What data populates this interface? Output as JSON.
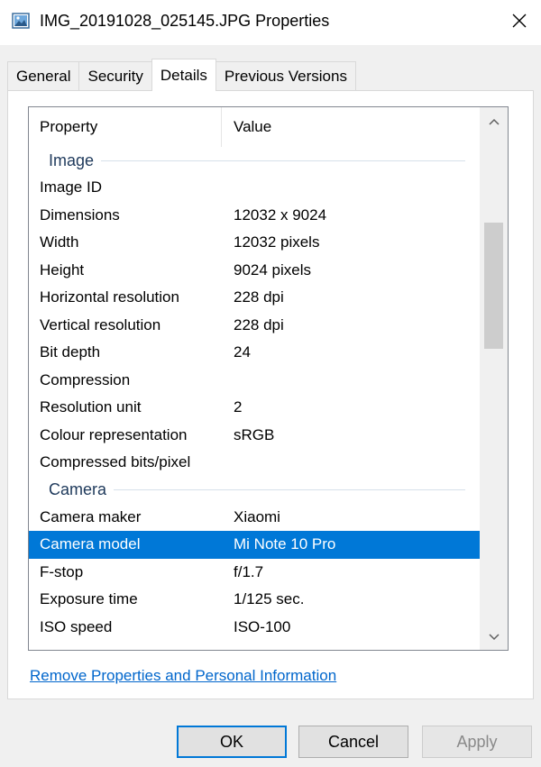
{
  "window": {
    "title": "IMG_20191028_025145.JPG Properties",
    "close_label": "✕"
  },
  "tabs": [
    {
      "label": "General"
    },
    {
      "label": "Security"
    },
    {
      "label": "Details"
    },
    {
      "label": "Previous Versions"
    }
  ],
  "active_tab": "Details",
  "list": {
    "col_property": "Property",
    "col_value": "Value",
    "group_image": "Image",
    "image_rows": [
      {
        "property": "Image ID",
        "value": ""
      },
      {
        "property": "Dimensions",
        "value": "12032 x 9024"
      },
      {
        "property": "Width",
        "value": "12032 pixels"
      },
      {
        "property": "Height",
        "value": "9024 pixels"
      },
      {
        "property": "Horizontal resolution",
        "value": "228 dpi"
      },
      {
        "property": "Vertical resolution",
        "value": "228 dpi"
      },
      {
        "property": "Bit depth",
        "value": "24"
      },
      {
        "property": "Compression",
        "value": ""
      },
      {
        "property": "Resolution unit",
        "value": "2"
      },
      {
        "property": "Colour representation",
        "value": "sRGB"
      },
      {
        "property": "Compressed bits/pixel",
        "value": ""
      }
    ],
    "group_camera": "Camera",
    "camera_rows": [
      {
        "property": "Camera maker",
        "value": "Xiaomi"
      },
      {
        "property": "Camera model",
        "value": "Mi Note 10 Pro"
      },
      {
        "property": "F-stop",
        "value": "f/1.7"
      },
      {
        "property": "Exposure time",
        "value": "1/125 sec."
      },
      {
        "property": "ISO speed",
        "value": "ISO-100"
      }
    ],
    "selected_row": "Camera model"
  },
  "remove_link": "Remove Properties and Personal Information",
  "buttons": {
    "ok": "OK",
    "cancel": "Cancel",
    "apply": "Apply"
  },
  "colors": {
    "selection": "#0078d7",
    "link": "#0066cc",
    "group_text": "#1e395b"
  },
  "icons": {
    "title": "image-file-icon",
    "close": "close-icon",
    "scroll_up": "chevron-up-icon",
    "scroll_down": "chevron-down-icon"
  }
}
